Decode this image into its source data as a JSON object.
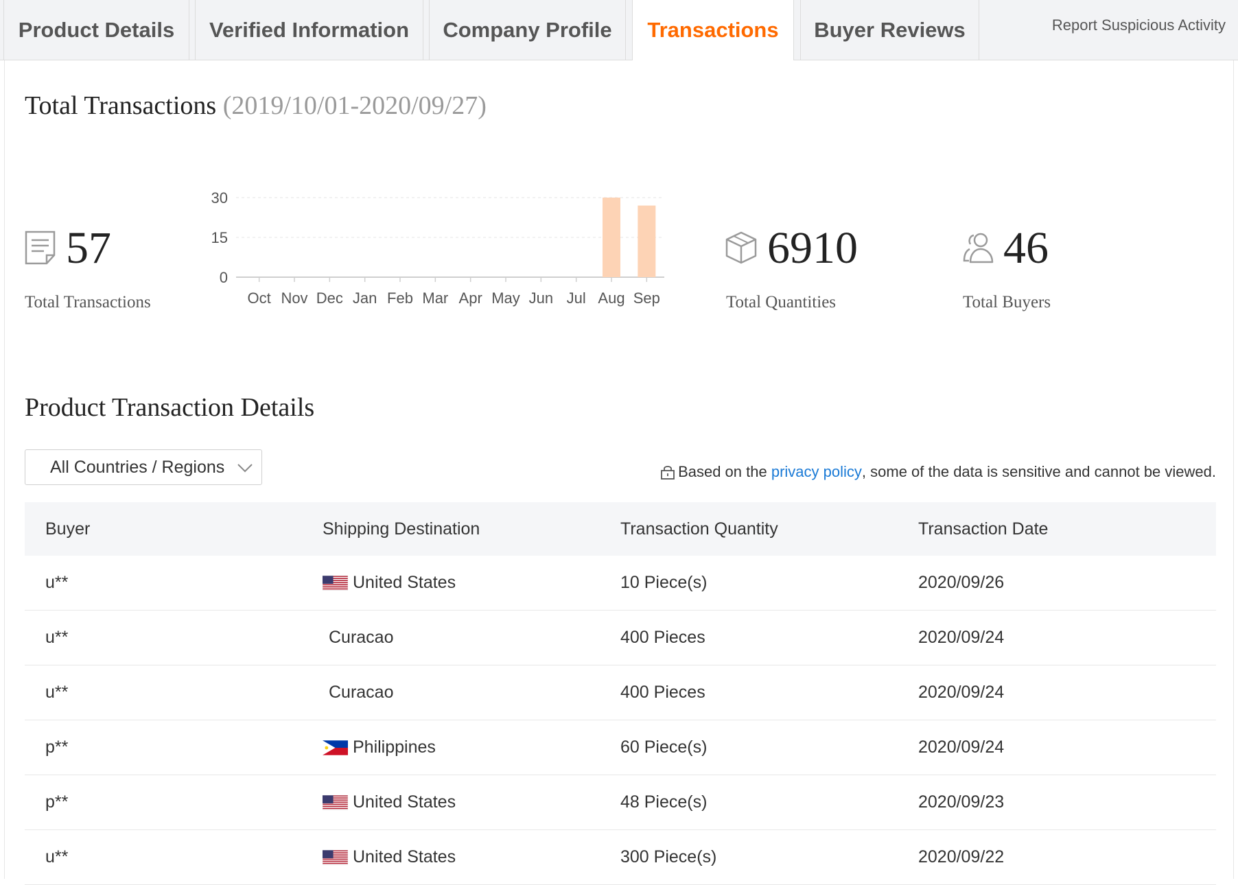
{
  "tabs": [
    {
      "label": "Product Details",
      "active": false
    },
    {
      "label": "Verified Information",
      "active": false
    },
    {
      "label": "Company Profile",
      "active": false
    },
    {
      "label": "Transactions",
      "active": true
    },
    {
      "label": "Buyer Reviews",
      "active": false
    }
  ],
  "report_link": "Report Suspicious Activity",
  "summary": {
    "title": "Total Transactions",
    "date_range": "(2019/10/01-2020/09/27)",
    "total_transactions": {
      "value": "57",
      "label": "Total Transactions",
      "icon": "document-icon"
    },
    "total_quantities": {
      "value": "6910",
      "label": "Total Quantities",
      "icon": "box-icon"
    },
    "total_buyers": {
      "value": "46",
      "label": "Total Buyers",
      "icon": "users-icon"
    }
  },
  "chart_data": {
    "type": "bar",
    "categories": [
      "Oct",
      "Nov",
      "Dec",
      "Jan",
      "Feb",
      "Mar",
      "Apr",
      "May",
      "Jun",
      "Jul",
      "Aug",
      "Sep"
    ],
    "values": [
      0,
      0,
      0,
      0,
      0,
      0,
      0,
      0,
      0,
      0,
      30,
      27
    ],
    "yticks": [
      0,
      15,
      30
    ],
    "ylim": [
      0,
      30
    ],
    "grid": true,
    "bar_color": "#fdd3b5",
    "title": "",
    "xlabel": "",
    "ylabel": ""
  },
  "details": {
    "title": "Product Transaction Details",
    "filter_label": "All Countries / Regions",
    "privacy_prefix": "Based on the ",
    "privacy_link": "privacy policy",
    "privacy_suffix": ", some of the data is sensitive and cannot be viewed.",
    "columns": [
      "Buyer",
      "Shipping Destination",
      "Transaction Quantity",
      "Transaction Date"
    ],
    "rows": [
      {
        "buyer": "u**",
        "destination": "United States",
        "flag": "us-flag-icon",
        "quantity": "10 Piece(s)",
        "date": "2020/09/26"
      },
      {
        "buyer": "u**",
        "destination": "Curacao",
        "flag": "",
        "quantity": "400 Pieces",
        "date": "2020/09/24"
      },
      {
        "buyer": "u**",
        "destination": "Curacao",
        "flag": "",
        "quantity": "400 Pieces",
        "date": "2020/09/24"
      },
      {
        "buyer": "p**",
        "destination": "Philippines",
        "flag": "ph-flag-icon",
        "quantity": "60 Piece(s)",
        "date": "2020/09/24"
      },
      {
        "buyer": "p**",
        "destination": "United States",
        "flag": "us-flag-icon",
        "quantity": "48 Piece(s)",
        "date": "2020/09/23"
      },
      {
        "buyer": "u**",
        "destination": "United States",
        "flag": "us-flag-icon",
        "quantity": "300 Piece(s)",
        "date": "2020/09/22"
      }
    ]
  },
  "colors": {
    "accent": "#ff6a00",
    "link": "#1a7ad6",
    "bar": "#fdd3b5"
  }
}
